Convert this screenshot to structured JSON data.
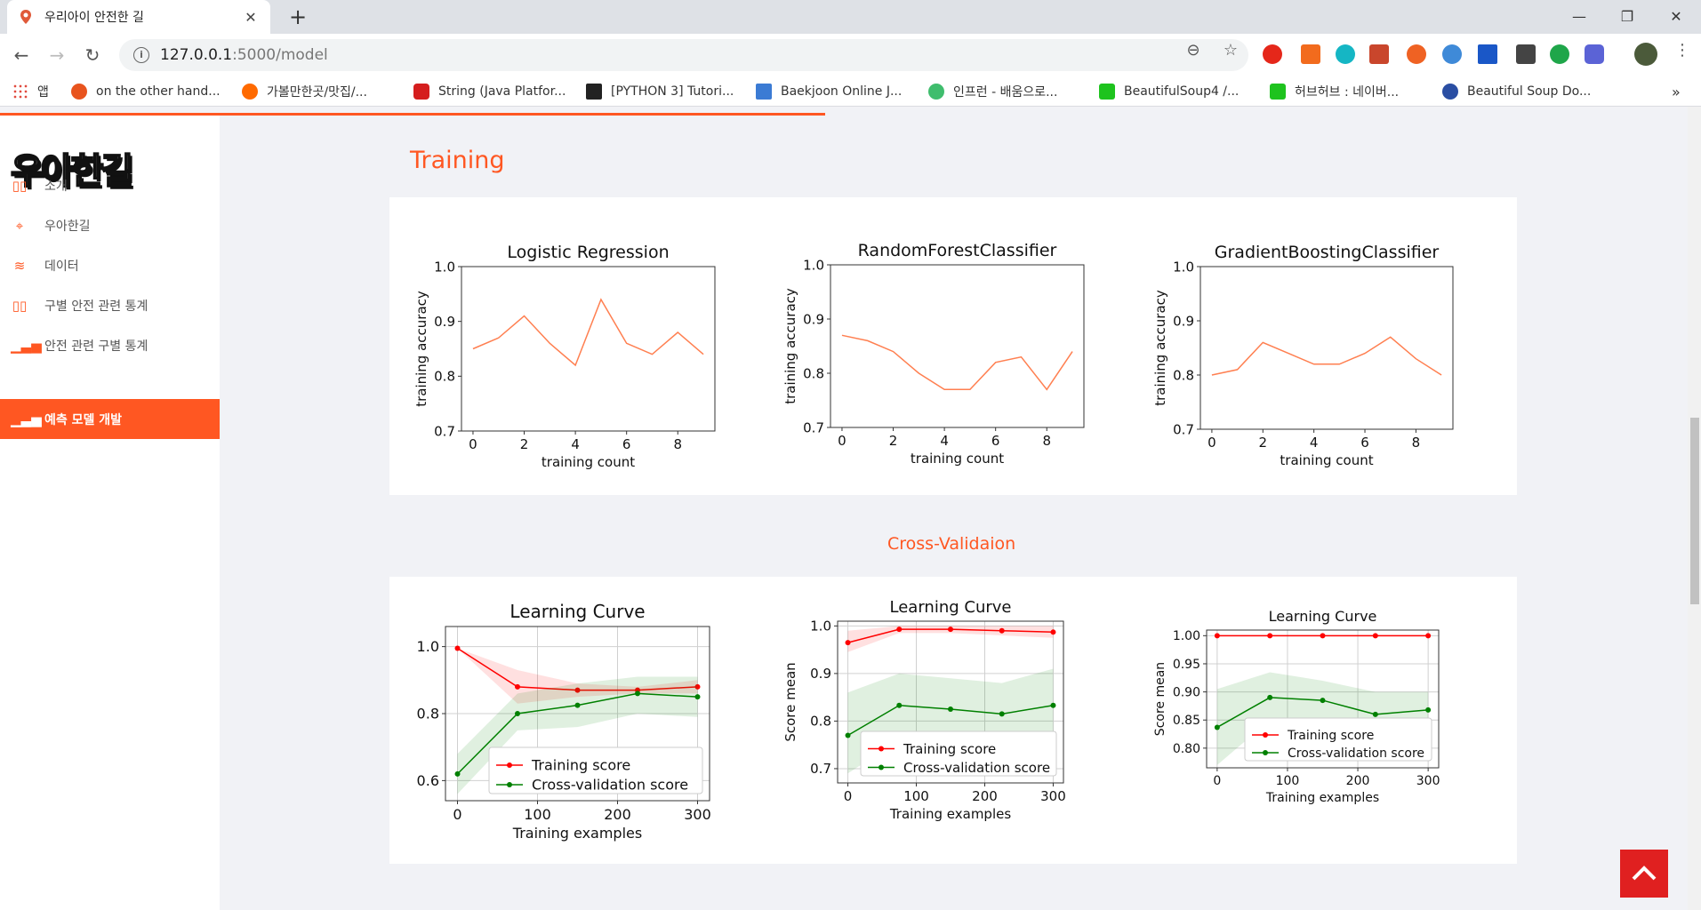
{
  "browser": {
    "tab_title": "우리아이 안전한 길",
    "new_tab": "+",
    "url_host": "127.0.0.1",
    "url_path": ":5000/model",
    "bookmarks": [
      {
        "label": "앱",
        "color": "#e04a3f"
      },
      {
        "label": "on the other hand...",
        "color": "#e8541e"
      },
      {
        "label": "가볼만한곳/맛집/...",
        "color": "#ff6a00"
      },
      {
        "label": "String (Java Platfor...",
        "color": "#d51e1e"
      },
      {
        "label": "[PYTHON 3] Tutori...",
        "color": "#222222"
      },
      {
        "label": "Baekjoon Online J...",
        "color": "#3b7bd4"
      },
      {
        "label": "인프런 - 배움으로...",
        "color": "#3fbd6d"
      },
      {
        "label": "BeautifulSoup4 /...",
        "color": "#1ec31e"
      },
      {
        "label": "허브허브 : 네이버...",
        "color": "#1ec31e"
      },
      {
        "label": "Beautiful Soup Do...",
        "color": "#2a4ea3"
      }
    ],
    "more_bookmarks": "»"
  },
  "sidebar": {
    "logo": "우아한길",
    "items": [
      {
        "label": "소개",
        "icon": "book-icon",
        "glyph": "▯▯"
      },
      {
        "label": "우아한길",
        "icon": "map-pin-icon",
        "glyph": "⌖"
      },
      {
        "label": "데이터",
        "icon": "database-icon",
        "glyph": "≋"
      },
      {
        "label": "구별 안전 관련 통계",
        "icon": "map-icon",
        "glyph": "▯▯"
      },
      {
        "label": "안전 관련 구별 통계",
        "icon": "bar-chart-icon",
        "glyph": "▁▃▅"
      },
      {
        "label": "예측 모델 개발",
        "icon": "bar-chart-icon",
        "glyph": "▁▃▅",
        "active": true
      }
    ]
  },
  "main": {
    "heading": "Training",
    "subheading": "Cross-Validaion"
  },
  "colors": {
    "accent": "#ff5722",
    "line": "#ff7f50",
    "train": "#ff0000",
    "cv": "#008000"
  },
  "chart_data": [
    {
      "type": "line",
      "title": "Logistic Regression",
      "xlabel": "training count",
      "ylabel": "training accuracy",
      "x": [
        0,
        1,
        2,
        3,
        4,
        5,
        6,
        7,
        8,
        9
      ],
      "values": [
        0.85,
        0.87,
        0.91,
        0.86,
        0.82,
        0.94,
        0.86,
        0.84,
        0.88,
        0.84
      ],
      "xlim": [
        -0.45,
        9.45
      ],
      "ylim": [
        0.7,
        1.0
      ],
      "xticks": [
        0,
        2,
        4,
        6,
        8
      ],
      "yticks": [
        0.7,
        0.8,
        0.9,
        1.0
      ],
      "xtick_labels": [
        "0",
        "2",
        "4",
        "6",
        "8"
      ],
      "ytick_labels": [
        "0.7",
        "0.8",
        "0.9",
        "1.0"
      ]
    },
    {
      "type": "line",
      "title": "RandomForestClassifier",
      "xlabel": "training count",
      "ylabel": "training accuracy",
      "x": [
        0,
        1,
        2,
        3,
        4,
        5,
        6,
        7,
        8,
        9
      ],
      "values": [
        0.87,
        0.86,
        0.84,
        0.8,
        0.77,
        0.77,
        0.82,
        0.83,
        0.77,
        0.84
      ],
      "xlim": [
        -0.45,
        9.45
      ],
      "ylim": [
        0.7,
        1.0
      ],
      "xticks": [
        0,
        2,
        4,
        6,
        8
      ],
      "yticks": [
        0.7,
        0.8,
        0.9,
        1.0
      ],
      "xtick_labels": [
        "0",
        "2",
        "4",
        "6",
        "8"
      ],
      "ytick_labels": [
        "0.7",
        "0.8",
        "0.9",
        "1.0"
      ]
    },
    {
      "type": "line",
      "title": "GradientBoostingClassifier",
      "xlabel": "training count",
      "ylabel": "training accuracy",
      "x": [
        0,
        1,
        2,
        3,
        4,
        5,
        6,
        7,
        8,
        9
      ],
      "values": [
        0.8,
        0.81,
        0.86,
        0.84,
        0.82,
        0.82,
        0.84,
        0.87,
        0.83,
        0.8
      ],
      "xlim": [
        -0.45,
        9.45
      ],
      "ylim": [
        0.7,
        1.0
      ],
      "xticks": [
        0,
        2,
        4,
        6,
        8
      ],
      "yticks": [
        0.7,
        0.8,
        0.9,
        1.0
      ],
      "xtick_labels": [
        "0",
        "2",
        "4",
        "6",
        "8"
      ],
      "ytick_labels": [
        "0.7",
        "0.8",
        "0.9",
        "1.0"
      ]
    },
    {
      "type": "line",
      "title": "Learning Curve",
      "xlabel": "Training examples",
      "ylabel": "",
      "x": [
        0,
        75,
        150,
        225,
        300
      ],
      "series": [
        {
          "name": "Training score",
          "values": [
            0.995,
            0.88,
            0.87,
            0.87,
            0.88
          ],
          "band": [
            [
              0.995,
              0.995
            ],
            [
              0.83,
              0.93
            ],
            [
              0.85,
              0.89
            ],
            [
              0.86,
              0.88
            ],
            [
              0.86,
              0.9
            ]
          ]
        },
        {
          "name": "Cross-validation score",
          "values": [
            0.62,
            0.8,
            0.825,
            0.86,
            0.85
          ],
          "band": [
            [
              0.56,
              0.68
            ],
            [
              0.75,
              0.86
            ],
            [
              0.76,
              0.89
            ],
            [
              0.8,
              0.91
            ],
            [
              0.79,
              0.91
            ]
          ]
        }
      ],
      "xlim": [
        -15,
        315
      ],
      "ylim": [
        0.54,
        1.06
      ],
      "xticks": [
        0,
        100,
        200,
        300
      ],
      "yticks": [
        0.6,
        0.8,
        1.0
      ],
      "xtick_labels": [
        "0",
        "100",
        "200",
        "300"
      ],
      "ytick_labels": [
        "0.6",
        "0.8",
        "1.0"
      ],
      "legend": "lower-right",
      "grid": true
    },
    {
      "type": "line",
      "title": "Learning Curve",
      "xlabel": "Training examples",
      "ylabel": "Score mean",
      "x": [
        0,
        75,
        150,
        225,
        300
      ],
      "series": [
        {
          "name": "Training score",
          "values": [
            0.965,
            0.993,
            0.993,
            0.99,
            0.987
          ],
          "band": [
            [
              0.945,
              0.99
            ],
            [
              0.985,
              1.0
            ],
            [
              0.985,
              1.0
            ],
            [
              0.98,
              1.0
            ],
            [
              0.975,
              1.0
            ]
          ]
        },
        {
          "name": "Cross-validation score",
          "values": [
            0.77,
            0.833,
            0.825,
            0.815,
            0.833
          ],
          "band": [
            [
              0.69,
              0.86
            ],
            [
              0.76,
              0.9
            ],
            [
              0.76,
              0.89
            ],
            [
              0.74,
              0.88
            ],
            [
              0.76,
              0.91
            ]
          ]
        }
      ],
      "xlim": [
        -15,
        315
      ],
      "ylim": [
        0.67,
        1.01
      ],
      "xticks": [
        0,
        100,
        200,
        300
      ],
      "yticks": [
        0.7,
        0.8,
        0.9,
        1.0
      ],
      "xtick_labels": [
        "0",
        "100",
        "200",
        "300"
      ],
      "ytick_labels": [
        "0.7",
        "0.8",
        "0.9",
        "1.0"
      ],
      "legend": "lower-right",
      "grid": true
    },
    {
      "type": "line",
      "title": "Learning Curve",
      "xlabel": "Training examples",
      "ylabel": "Score mean",
      "x": [
        0,
        75,
        150,
        225,
        300
      ],
      "series": [
        {
          "name": "Training score",
          "values": [
            1.0,
            1.0,
            1.0,
            1.0,
            1.0
          ],
          "band": [
            [
              1.0,
              1.0
            ],
            [
              1.0,
              1.0
            ],
            [
              1.0,
              1.0
            ],
            [
              1.0,
              1.0
            ],
            [
              1.0,
              1.0
            ]
          ]
        },
        {
          "name": "Cross-validation score",
          "values": [
            0.837,
            0.89,
            0.885,
            0.86,
            0.868
          ],
          "band": [
            [
              0.77,
              0.905
            ],
            [
              0.85,
              0.935
            ],
            [
              0.85,
              0.92
            ],
            [
              0.82,
              0.9
            ],
            [
              0.83,
              0.9
            ]
          ]
        }
      ],
      "xlim": [
        -15,
        315
      ],
      "ylim": [
        0.765,
        1.01
      ],
      "xticks": [
        0,
        100,
        200,
        300
      ],
      "yticks": [
        0.8,
        0.85,
        0.9,
        0.95,
        1.0
      ],
      "xtick_labels": [
        "0",
        "100",
        "200",
        "300"
      ],
      "ytick_labels": [
        "0.80",
        "0.85",
        "0.90",
        "0.95",
        "1.00"
      ],
      "legend": "lower-right",
      "grid": true
    }
  ]
}
